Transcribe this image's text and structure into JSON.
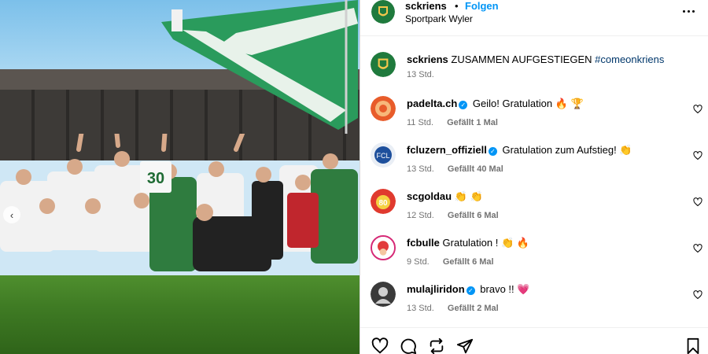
{
  "post": {
    "account": "sckriens",
    "separator": "•",
    "follow_label": "Folgen",
    "location": "Sportpark Wyler",
    "caption_user": "sckriens",
    "caption_text": "ZUSAMMEN AUFGESTIEGEN",
    "caption_hashtag": "#comeonkriens",
    "caption_time": "13 Std.",
    "jersey_number": "30"
  },
  "comments": [
    {
      "user": "padelta.ch",
      "verified": "✓",
      "text": "Geilo! Gratulation 🔥 🏆",
      "time": "11 Std.",
      "likes": "Gefällt 1 Mal"
    },
    {
      "user": "fcluzern_offiziell",
      "verified": "✓",
      "text": "Gratulation zum Aufstieg! 👏",
      "time": "13 Std.",
      "likes": "Gefällt 40 Mal"
    },
    {
      "user": "scgoldau",
      "text": "👏 👏",
      "time": "12 Std.",
      "likes": "Gefällt 6 Mal"
    },
    {
      "user": "fcbulle",
      "text": "Gratulation ! 👏 🔥",
      "time": "9 Std.",
      "likes": "Gefällt 6 Mal"
    },
    {
      "user": "mulajliridon",
      "verified": "✓",
      "text": "bravo !! 💗",
      "time": "13 Std.",
      "likes": "Gefällt 2 Mal"
    }
  ],
  "colors": {
    "accent": "#0095f6",
    "club_green": "#1f7a3d",
    "flag_green": "#2d9a5a"
  },
  "icons": [
    "more-options-icon",
    "heart-icon",
    "comment-icon",
    "share-icon",
    "send-icon",
    "bookmark-icon",
    "chevron-left-icon",
    "verified-icon"
  ]
}
